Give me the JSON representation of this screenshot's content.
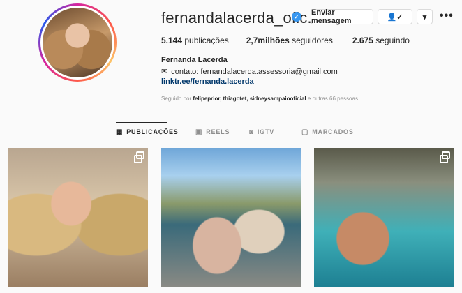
{
  "profile": {
    "username": "fernandalacerda_oficial",
    "username_display": "fernandalacerda_ofic...",
    "full_name": "Fernanda Lacerda",
    "email_line": "contato: fernandalacerda.assessoria@gmail.com",
    "link": "linktr.ee/fernanda.lacerda",
    "verified_glyph": "✓"
  },
  "actions": {
    "message_label": "Enviar mensagem",
    "follow_glyph": "👤✓",
    "dropdown_glyph": "▾",
    "more_glyph": "•••"
  },
  "stats": {
    "posts_value": "5.144",
    "posts_label": "publicações",
    "followers_value": "2,7milhões",
    "followers_label": "seguidores",
    "following_value": "2.675",
    "following_label": "seguindo"
  },
  "followed_by": {
    "prefix": "Seguido por",
    "names": "felipeprior, thiagotet, sidneysampaiooficial",
    "suffix": "e outras 66 pessoas"
  },
  "tabs": [
    {
      "label": "PUBLICAÇÕES",
      "icon": "grid-icon",
      "glyph": "▦",
      "active": true
    },
    {
      "label": "REELS",
      "icon": "reels-icon",
      "glyph": "▣",
      "active": false
    },
    {
      "label": "IGTV",
      "icon": "igtv-icon",
      "glyph": "◙",
      "active": false
    },
    {
      "label": "MARCADOS",
      "icon": "tagged-icon",
      "glyph": "▢",
      "active": false
    }
  ],
  "posts": [
    {
      "type": "multi-image"
    },
    {
      "type": "image"
    },
    {
      "type": "multi-image"
    }
  ],
  "colors": {
    "verified": "#3897f0",
    "link": "#00376b",
    "muted": "#8e8e8e"
  }
}
